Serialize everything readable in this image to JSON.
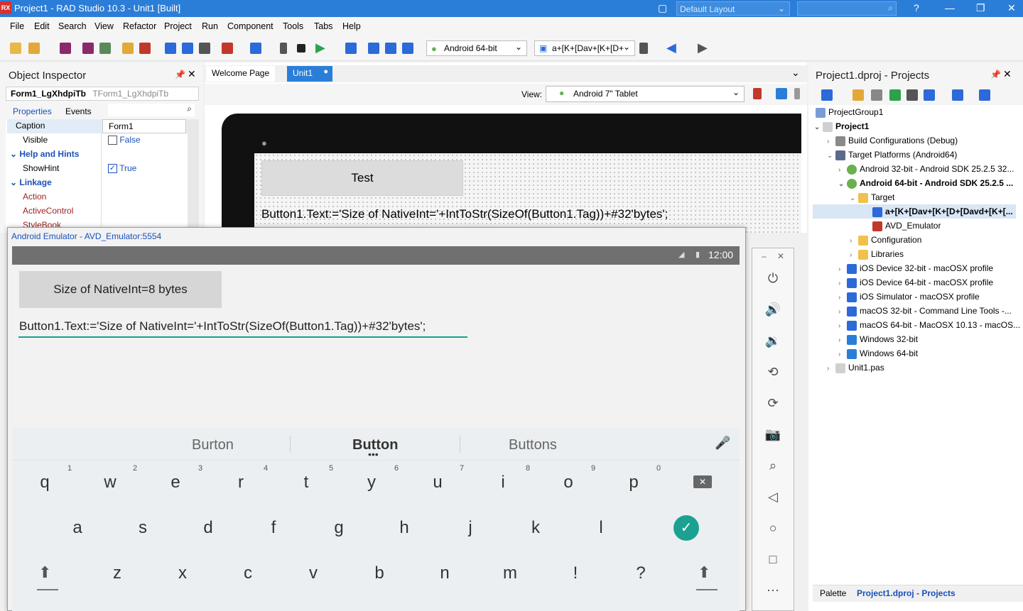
{
  "window": {
    "title": "Project1 - RAD Studio 10.3 - Unit1 [Built]",
    "layout": "Default Layout"
  },
  "menu": [
    "File",
    "Edit",
    "Search",
    "View",
    "Refactor",
    "Project",
    "Run",
    "Component",
    "Tools",
    "Tabs",
    "Help"
  ],
  "toolbar": {
    "platform": "Android 64-bit",
    "target": "a+[K+[Dav+[K+[D+"
  },
  "object_inspector": {
    "title": "Object Inspector",
    "component": "Form1_LgXhdpiTb",
    "component_type": "TForm1_LgXhdpiTb",
    "tabs": [
      "Properties",
      "Events"
    ],
    "rows": [
      {
        "name": "Caption",
        "value": "Form1"
      },
      {
        "name": "Visible",
        "value": "False"
      },
      {
        "name": "Help and Hints"
      },
      {
        "name": "ShowHint",
        "value": "True"
      },
      {
        "name": "Linkage"
      },
      {
        "name": "Action"
      },
      {
        "name": "ActiveControl"
      },
      {
        "name": "StyleBook"
      }
    ]
  },
  "designer": {
    "tabs": [
      "Welcome Page",
      "Unit1"
    ],
    "view_label": "View:",
    "view_value": "Android 7\" Tablet",
    "button_text": "Test",
    "edit_text": "Button1.Text:='Size of NativeInt='+IntToStr(SizeOf(Button1.Tag))+#32'bytes';"
  },
  "projects": {
    "title": "Project1.dproj - Projects",
    "items": [
      "ProjectGroup1",
      "Project1",
      "Build Configurations (Debug)",
      "Target Platforms (Android64)",
      "Android 32-bit - Android SDK 25.2.5 32...",
      "Android 64-bit - Android SDK 25.2.5 ...",
      "Target",
      "a+[K+[Dav+[K+[D+[Davd+[K+[...",
      "AVD_Emulator",
      "Configuration",
      "Libraries",
      "iOS Device 32-bit - macOSX profile",
      "iOS Device 64-bit - macOSX profile",
      "iOS Simulator - macOSX profile",
      "macOS 32-bit - Command Line Tools -...",
      "macOS 64-bit - MacOSX 10.13 - macOS...",
      "Windows 32-bit",
      "Windows 64-bit",
      "Unit1.pas"
    ],
    "bottom_tabs": [
      "Palette",
      "Project1.dproj - Projects"
    ]
  },
  "emulator": {
    "title": "Android Emulator - AVD_Emulator:5554",
    "time": "12:00",
    "button_text": "Size of NativeInt=8 bytes",
    "edit_text": "Button1.Text:='Size of NativeInt='+IntToStr(SizeOf(Button1.Tag))+#32'bytes';",
    "suggestions": [
      "Burton",
      "Button",
      "Buttons"
    ],
    "row1": [
      "q",
      "w",
      "e",
      "r",
      "t",
      "y",
      "u",
      "i",
      "o",
      "p"
    ],
    "row1_hints": [
      "1",
      "2",
      "3",
      "4",
      "5",
      "6",
      "7",
      "8",
      "9",
      "0"
    ],
    "row2": [
      "a",
      "s",
      "d",
      "f",
      "g",
      "h",
      "j",
      "k",
      "l"
    ],
    "row3": [
      "z",
      "x",
      "c",
      "v",
      "b",
      "n",
      "m",
      "!",
      "?"
    ]
  }
}
